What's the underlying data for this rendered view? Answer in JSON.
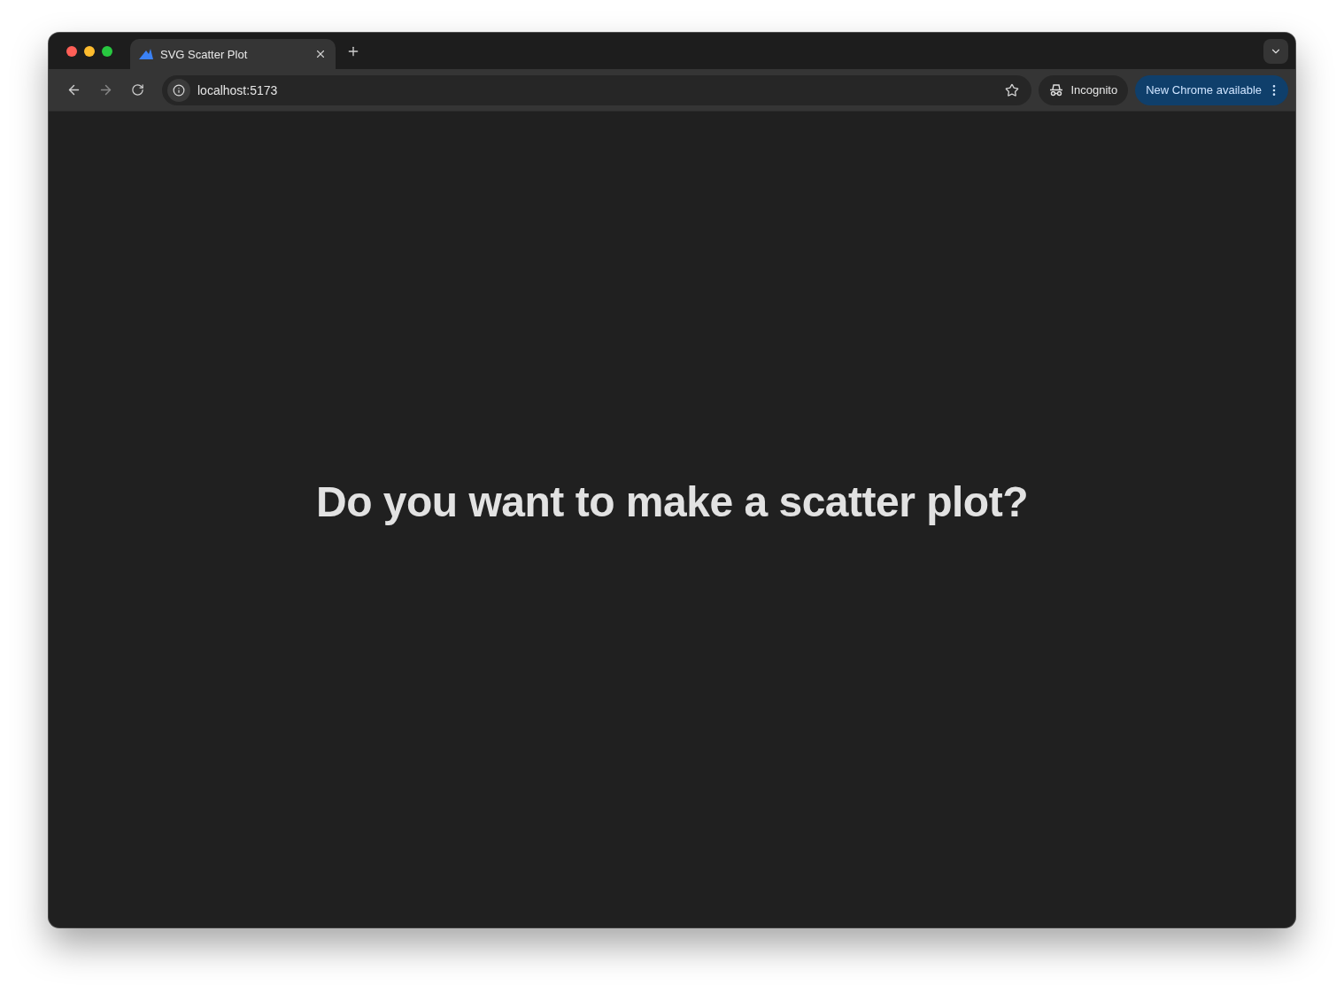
{
  "tabs": [
    {
      "title": "SVG Scatter Plot",
      "selected": true
    }
  ],
  "address_bar": {
    "url": "localhost:5173"
  },
  "profile": {
    "label": "Incognito"
  },
  "update_button": {
    "label": "New Chrome available"
  },
  "page": {
    "heading": "Do you want to make a scatter plot?"
  }
}
